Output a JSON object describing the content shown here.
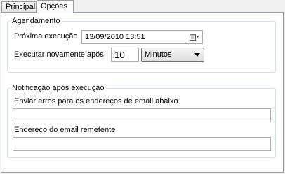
{
  "tabs": [
    {
      "label": "Principal"
    },
    {
      "label": "Opções"
    }
  ],
  "agendamento": {
    "title": "Agendamento",
    "proxima_label": "Próxima execução",
    "proxima_value": "13/09/2010 13:51",
    "executar_label": "Executar novamente após",
    "interval_value": "10",
    "unit_selected": "Minutos"
  },
  "notificacao": {
    "title": "Notificação após execução",
    "erros_label": "Enviar erros para os endereços de email abaixo",
    "erros_value": "",
    "remetente_label": "Endereço do email remetente",
    "remetente_value": ""
  }
}
